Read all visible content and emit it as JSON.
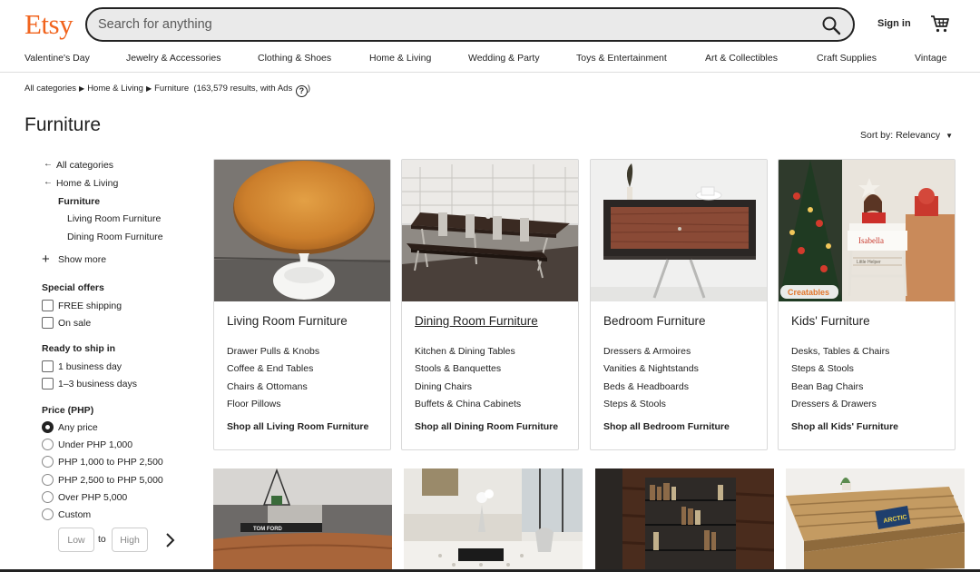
{
  "header": {
    "logo": "Etsy",
    "search_placeholder": "Search for anything",
    "signin": "Sign in"
  },
  "nav": [
    "Valentine's Day",
    "Jewelry & Accessories",
    "Clothing & Shoes",
    "Home & Living",
    "Wedding & Party",
    "Toys & Entertainment",
    "Art & Collectibles",
    "Craft Supplies",
    "Vintage"
  ],
  "breadcrumb": {
    "items": [
      "All categories",
      "Home & Living",
      "Furniture"
    ],
    "results": "(163,579 results, with Ads",
    "help": "?",
    "close": ")"
  },
  "page_title": "Furniture",
  "sort": {
    "label": "Sort by: Relevancy"
  },
  "sidebar": {
    "cat_all": "All categories",
    "cat_home": "Home & Living",
    "cat_current": "Furniture",
    "sub1": "Living Room Furniture",
    "sub2": "Dining Room Furniture",
    "show_more": "Show more",
    "special_title": "Special offers",
    "special": [
      "FREE shipping",
      "On sale"
    ],
    "ship_title": "Ready to ship in",
    "ship": [
      "1 business day",
      "1–3 business days"
    ],
    "price_title": "Price (PHP)",
    "price": [
      "Any price",
      "Under PHP 1,000",
      "PHP 1,000 to PHP 2,500",
      "PHP 2,500 to PHP 5,000",
      "Over PHP 5,000",
      "Custom"
    ],
    "price_selected": "Any price",
    "low_placeholder": "Low",
    "to": "to",
    "high_placeholder": "High"
  },
  "cards": [
    {
      "title": "Living Room Furniture",
      "links": [
        "Drawer Pulls & Knobs",
        "Coffee & End Tables",
        "Chairs & Ottomans",
        "Floor Pillows"
      ],
      "shop_all": "Shop all Living Room Furniture"
    },
    {
      "title": "Dining Room Furniture",
      "links": [
        "Kitchen & Dining Tables",
        "Stools & Banquettes",
        "Dining Chairs",
        "Buffets & China Cabinets"
      ],
      "shop_all": "Shop all Dining Room Furniture"
    },
    {
      "title": "Bedroom Furniture",
      "links": [
        "Dressers & Armoires",
        "Vanities & Nightstands",
        "Beds & Headboards",
        "Steps & Stools"
      ],
      "shop_all": "Shop all Bedroom Furniture"
    },
    {
      "title": "Kids' Furniture",
      "links": [
        "Desks, Tables & Chairs",
        "Steps & Stools",
        "Bean Bag Chairs",
        "Dressers & Drawers"
      ],
      "shop_all": "Shop all Kids' Furniture"
    }
  ],
  "image_text": {
    "kids_name": "Isabella",
    "kids_sign": "Little Helper",
    "kids_watermark": "Creatables",
    "book": "ARCTIC",
    "coffee_book": "TOM FORD"
  },
  "colors": {
    "brand": "#f1641e",
    "text": "#222222"
  }
}
